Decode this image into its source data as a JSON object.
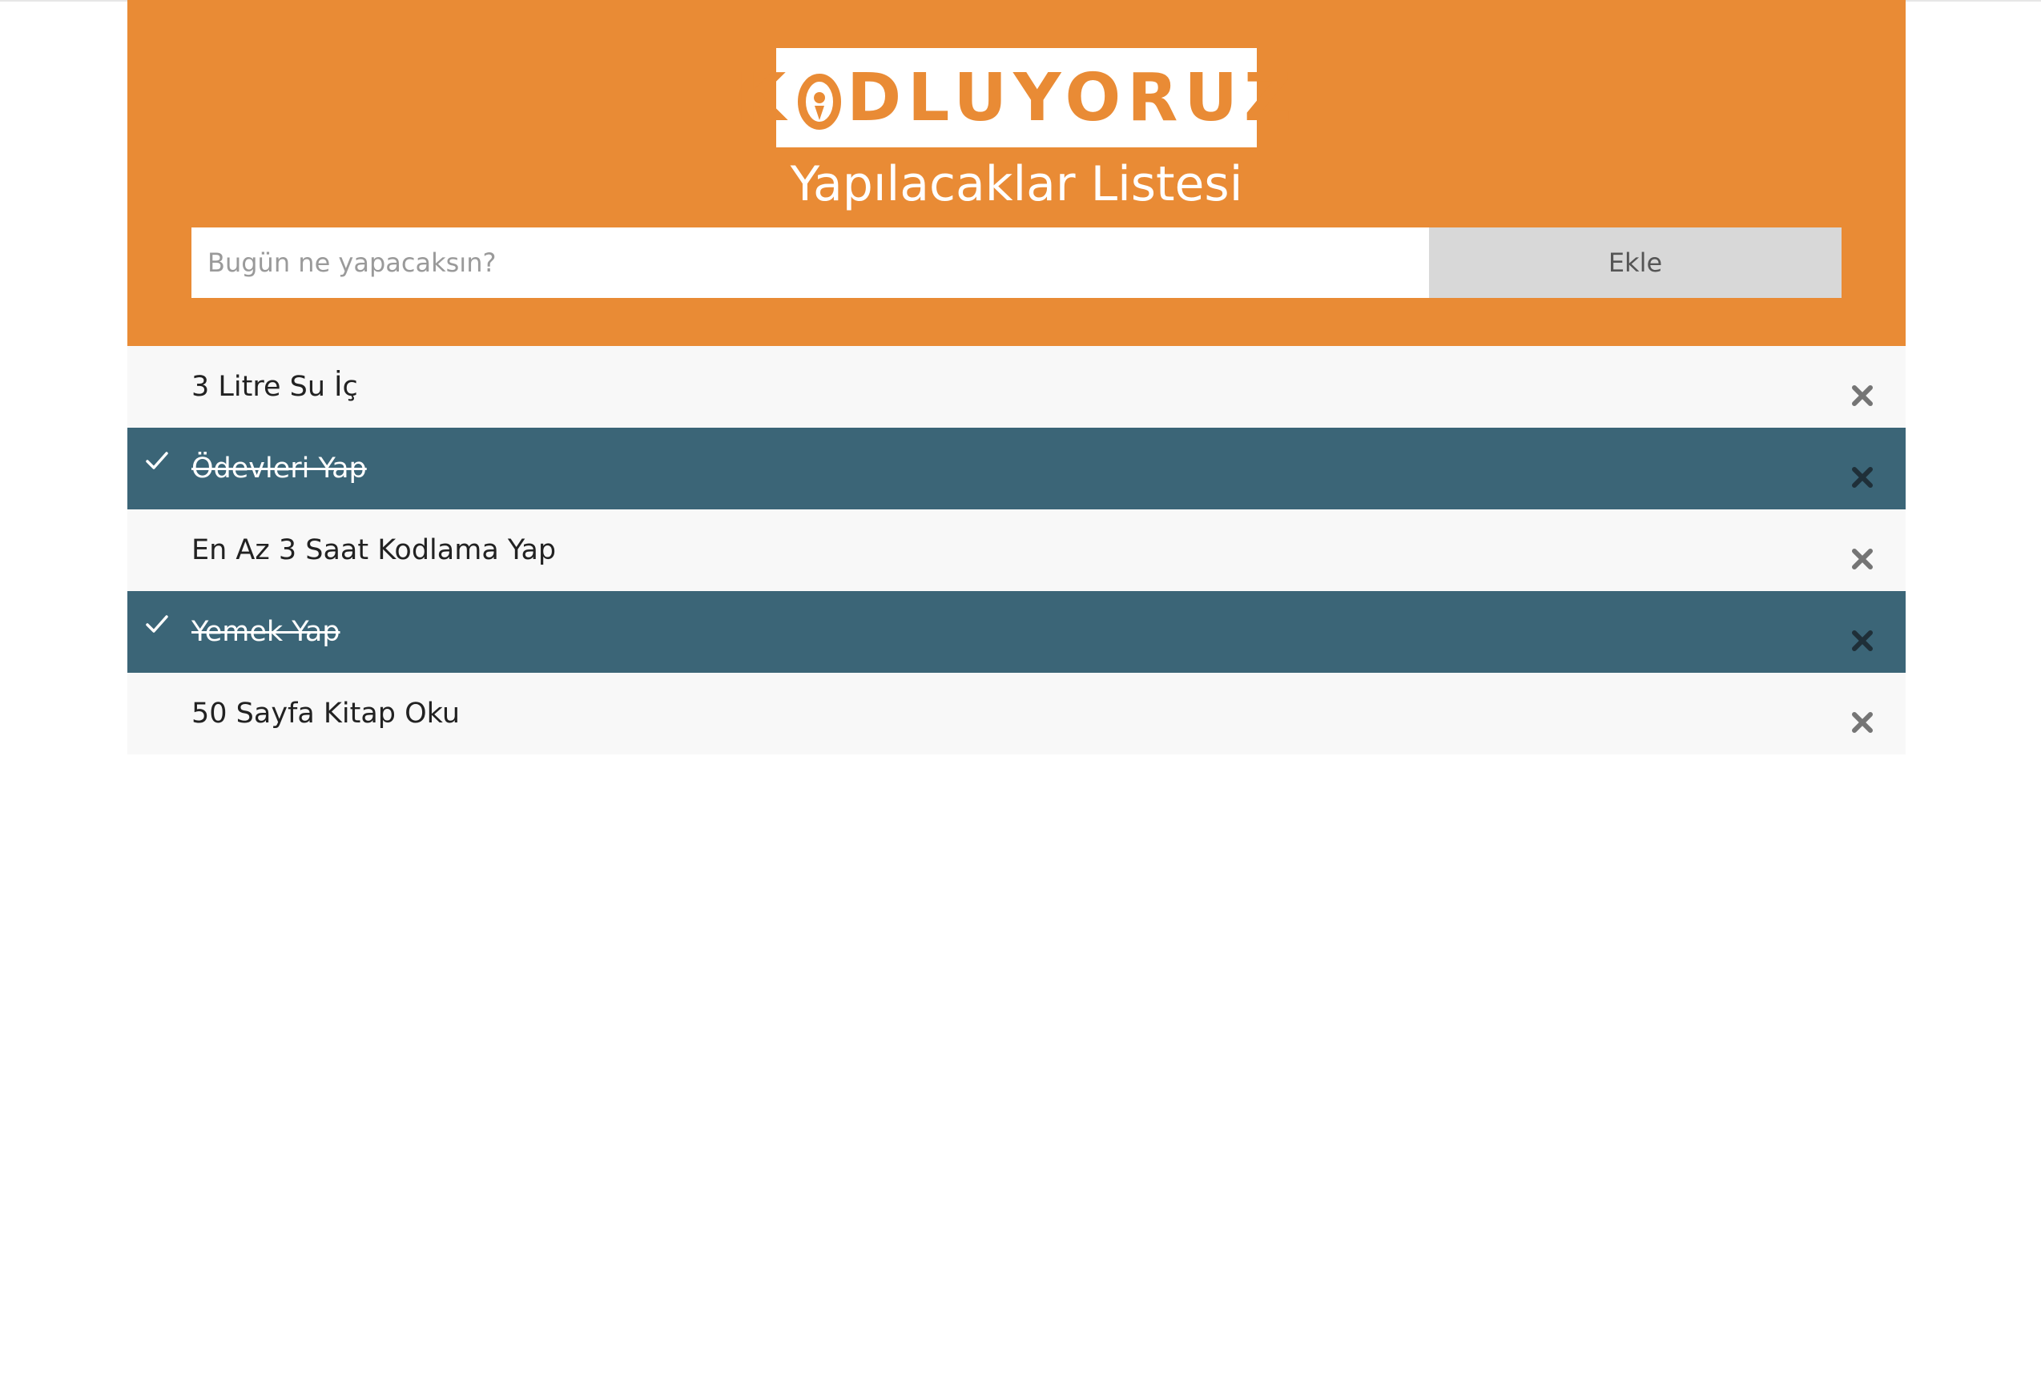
{
  "colors": {
    "header_bg": "#e98b35",
    "logo_orange": "#e98b35",
    "checked_bg": "#3b6577",
    "unchecked_bg": "#f8f8f8",
    "close_unchecked": "#757575",
    "close_checked": "#1f2f38",
    "check_mark": "#ffffff"
  },
  "logo": {
    "text_k": "K",
    "text_rest": "DLUYORUZ",
    "alt": "KODLUYORUZ"
  },
  "header": {
    "title": "Yapılacaklar Listesi"
  },
  "form": {
    "placeholder": "Bugün ne yapacaksın?",
    "value": "",
    "add_label": "Ekle"
  },
  "todos": [
    {
      "text": "3 Litre Su İç",
      "checked": false
    },
    {
      "text": "Ödevleri Yap",
      "checked": true
    },
    {
      "text": "En Az 3 Saat Kodlama Yap",
      "checked": false
    },
    {
      "text": "Yemek Yap",
      "checked": true
    },
    {
      "text": "50 Sayfa Kitap Oku",
      "checked": false
    }
  ],
  "icons": {
    "check": "check-icon",
    "close": "close-icon"
  }
}
